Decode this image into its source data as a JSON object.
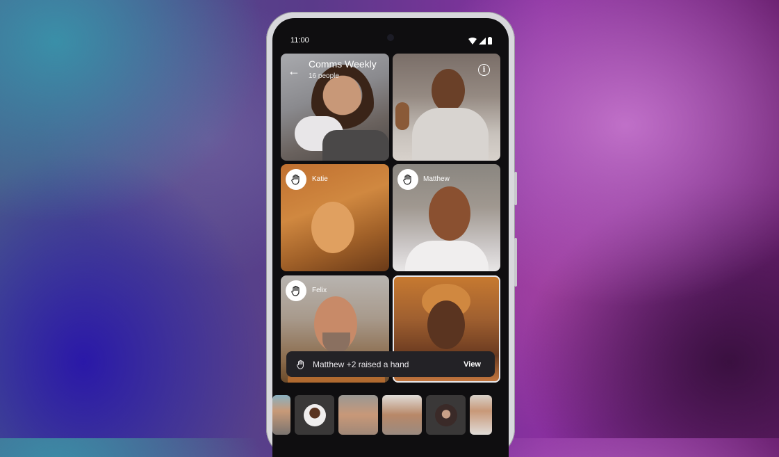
{
  "status_bar": {
    "time": "11:00",
    "icons": [
      "wifi-icon",
      "signal-icon",
      "battery-icon"
    ]
  },
  "call": {
    "title": "Comms Weekly",
    "subtitle": "16 people",
    "back_icon": "←",
    "info_icon": "i"
  },
  "participants": [
    {
      "name": "",
      "hand_raised": false
    },
    {
      "name": "",
      "hand_raised": false
    },
    {
      "name": "Katie",
      "hand_raised": true
    },
    {
      "name": "Matthew",
      "hand_raised": true
    },
    {
      "name": "Felix",
      "hand_raised": true
    },
    {
      "name": "",
      "hand_raised": false,
      "active_speaker": true
    }
  ],
  "toast": {
    "message": "Matthew +2 raised a hand",
    "action": "View"
  },
  "filmstrip": {
    "count": 6
  }
}
